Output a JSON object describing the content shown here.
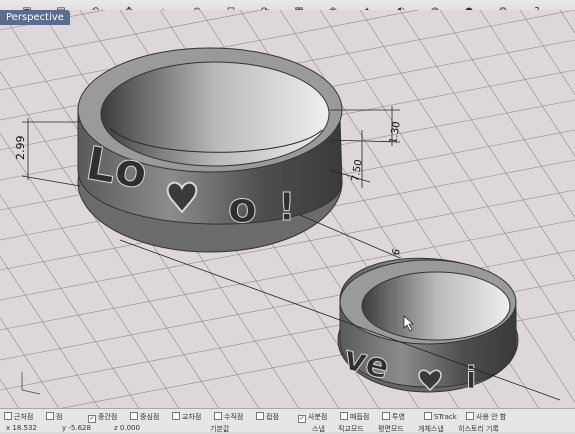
{
  "viewport": {
    "tab_label": "Perspective",
    "background": "#ddd7dc",
    "grid_color": "#8d8a8f"
  },
  "toolbar": {
    "icons": [
      "box-icon",
      "folder-icon",
      "undo-icon",
      "pan-icon",
      "zoom-icon",
      "zoom-window-icon",
      "zoom-extents-icon",
      "rotate-icon",
      "grid-icon",
      "color-icon",
      "light-icon",
      "render-icon",
      "material-icon",
      "sphere-icon",
      "gear-icon",
      "help-icon"
    ]
  },
  "dimensions": {
    "d1": "2.99",
    "d2": "1.30",
    "d3": "7.50",
    "d4": "6"
  },
  "ring_large": {
    "letters": [
      "Lo",
      "o",
      "!"
    ]
  },
  "ring_small": {
    "letters": [
      "ve",
      "i"
    ]
  },
  "statusbar": {
    "snaps": [
      {
        "label": "근처점",
        "checked": false
      },
      {
        "label": "점",
        "checked": false
      },
      {
        "label": "중간점",
        "checked": true
      },
      {
        "label": "중심점",
        "checked": false
      },
      {
        "label": "교차점",
        "checked": false
      },
      {
        "label": "수직점",
        "checked": false
      },
      {
        "label": "접점",
        "checked": false
      },
      {
        "label": "사분점",
        "checked": true
      },
      {
        "label": "매듭점",
        "checked": false
      },
      {
        "label": "투영",
        "checked": false
      },
      {
        "label": "STrack",
        "checked": false
      },
      {
        "label": "사용 안 함",
        "checked": false
      }
    ],
    "x_coord": "x 18.532",
    "y_coord": "y -5.628",
    "z_coord": "z 0.000",
    "layer": "기본값",
    "modes": [
      "스냅",
      "직교모드",
      "평면모드",
      "개체스냅",
      "히스토리 기록"
    ]
  }
}
